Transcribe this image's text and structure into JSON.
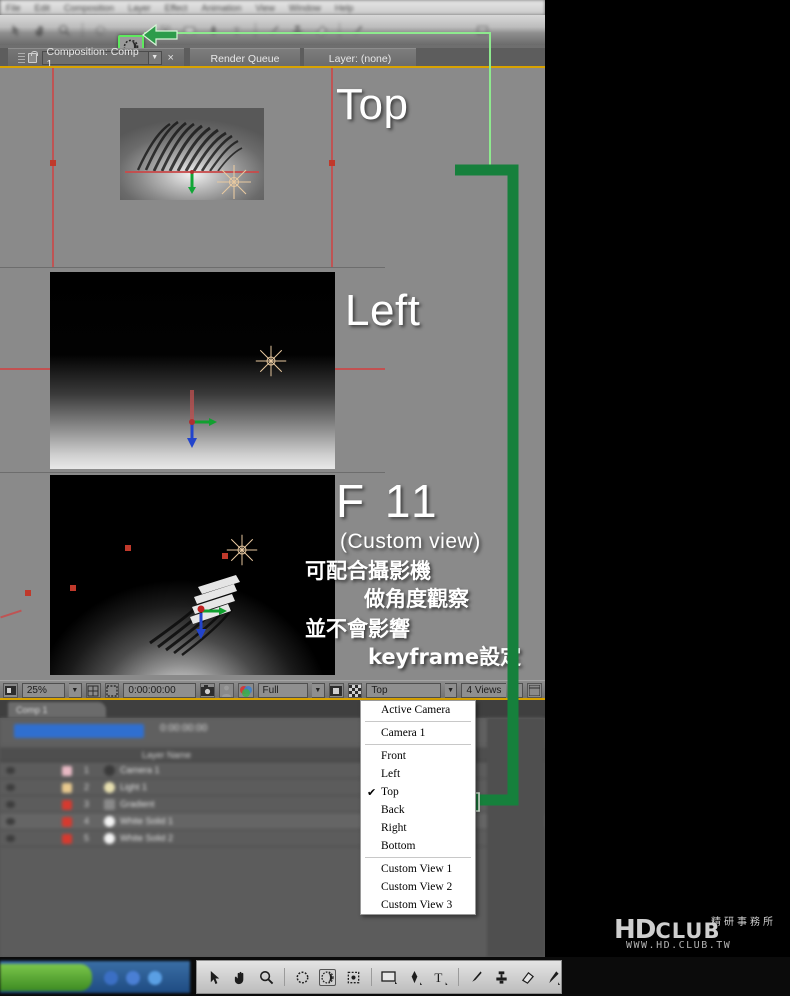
{
  "app": {
    "menu": [
      "File",
      "Edit",
      "Composition",
      "Layer",
      "Effect",
      "Animation",
      "View",
      "Window",
      "Help"
    ],
    "tabs": [
      {
        "label": "Composition: Comp 1",
        "active": true
      },
      {
        "label": "Render Queue",
        "active": false
      },
      {
        "label": "Layer: (none)",
        "active": false
      }
    ],
    "close_label": "×",
    "dropdown_caret": "▼"
  },
  "toolbar": {
    "highlighted_tool": "orbit-camera-tool",
    "tools": [
      "selection-tool",
      "hand-tool",
      "zoom-tool",
      "rotation-tool",
      "orbit-camera-tool",
      "track-xy-camera-tool",
      "mask-rect-tool",
      "pen-tool",
      "text-tool",
      "brush-tool",
      "clone-stamp-tool",
      "eraser-tool",
      "puppet-pin-tool"
    ]
  },
  "viewports": {
    "top_label": "Top",
    "left_label": "Left",
    "custom_key": "F  11",
    "custom_sub": "(Custom view)"
  },
  "annotations": {
    "cjk_line1": "可配合攝影機",
    "cjk_line2": "做角度觀察",
    "cjk_line3": "並不會影響",
    "cjk_line4": "keyframe設定",
    "arrow_color": "#16803c",
    "highlight_color": "#5eea5e"
  },
  "viewer_bar": {
    "zoom": "25%",
    "timecode": "0:00:00:00",
    "resolution": "Full",
    "view_selected": "Top",
    "view_layout": "4 Views",
    "icons": [
      "always-preview-icon",
      "grid-icon",
      "mask-icon",
      "snapshot-icon",
      "show-snapshot-icon",
      "channels-icon",
      "region-of-interest-icon",
      "transparency-grid-icon",
      "panel-menu-icon"
    ]
  },
  "view_menu": {
    "groups": [
      [
        {
          "label": "Active Camera",
          "checked": false
        }
      ],
      [
        {
          "label": "Camera 1",
          "checked": false
        }
      ],
      [
        {
          "label": "Front",
          "checked": false
        },
        {
          "label": "Left",
          "checked": false
        },
        {
          "label": "Top",
          "checked": true
        },
        {
          "label": "Back",
          "checked": false
        },
        {
          "label": "Right",
          "checked": false
        },
        {
          "label": "Bottom",
          "checked": false
        }
      ],
      [
        {
          "label": "Custom View 1",
          "checked": false
        },
        {
          "label": "Custom View 2",
          "checked": false
        },
        {
          "label": "Custom View 3",
          "checked": false
        }
      ]
    ],
    "check_glyph": "✔"
  },
  "timeline": {
    "tab_label": "Comp 1",
    "search_placeholder": "",
    "timecode": "0:00:00:00",
    "column_header": "Layer Name",
    "rows": [
      {
        "num": "1",
        "name": "Camera 1",
        "color": "#e8b9c4"
      },
      {
        "num": "2",
        "name": "Light 1",
        "color": "#e8c98e"
      },
      {
        "num": "3",
        "name": "Gradient",
        "color": "#d63a2f"
      },
      {
        "num": "4",
        "name": "White Solid 1",
        "color": "#d63a2f"
      },
      {
        "num": "5",
        "name": "White Solid 2",
        "color": "#d63a2f"
      }
    ]
  },
  "watermark": {
    "brand": "HD",
    "brand2": "CLUB",
    "cjk": "精研事務所",
    "url": "WWW.HD.CLUB.TW"
  },
  "taskbar": {
    "start_label": "",
    "ae_tools": [
      "selection-tool",
      "hand-tool",
      "zoom-tool",
      "rotation-tool",
      "orbit-camera-tool",
      "track-xy-camera-tool",
      "rectangle-tool",
      "pen-tool",
      "text-tool",
      "brush-tool",
      "clone-stamp-tool",
      "eraser-tool",
      "puppet-pin-tool"
    ]
  }
}
